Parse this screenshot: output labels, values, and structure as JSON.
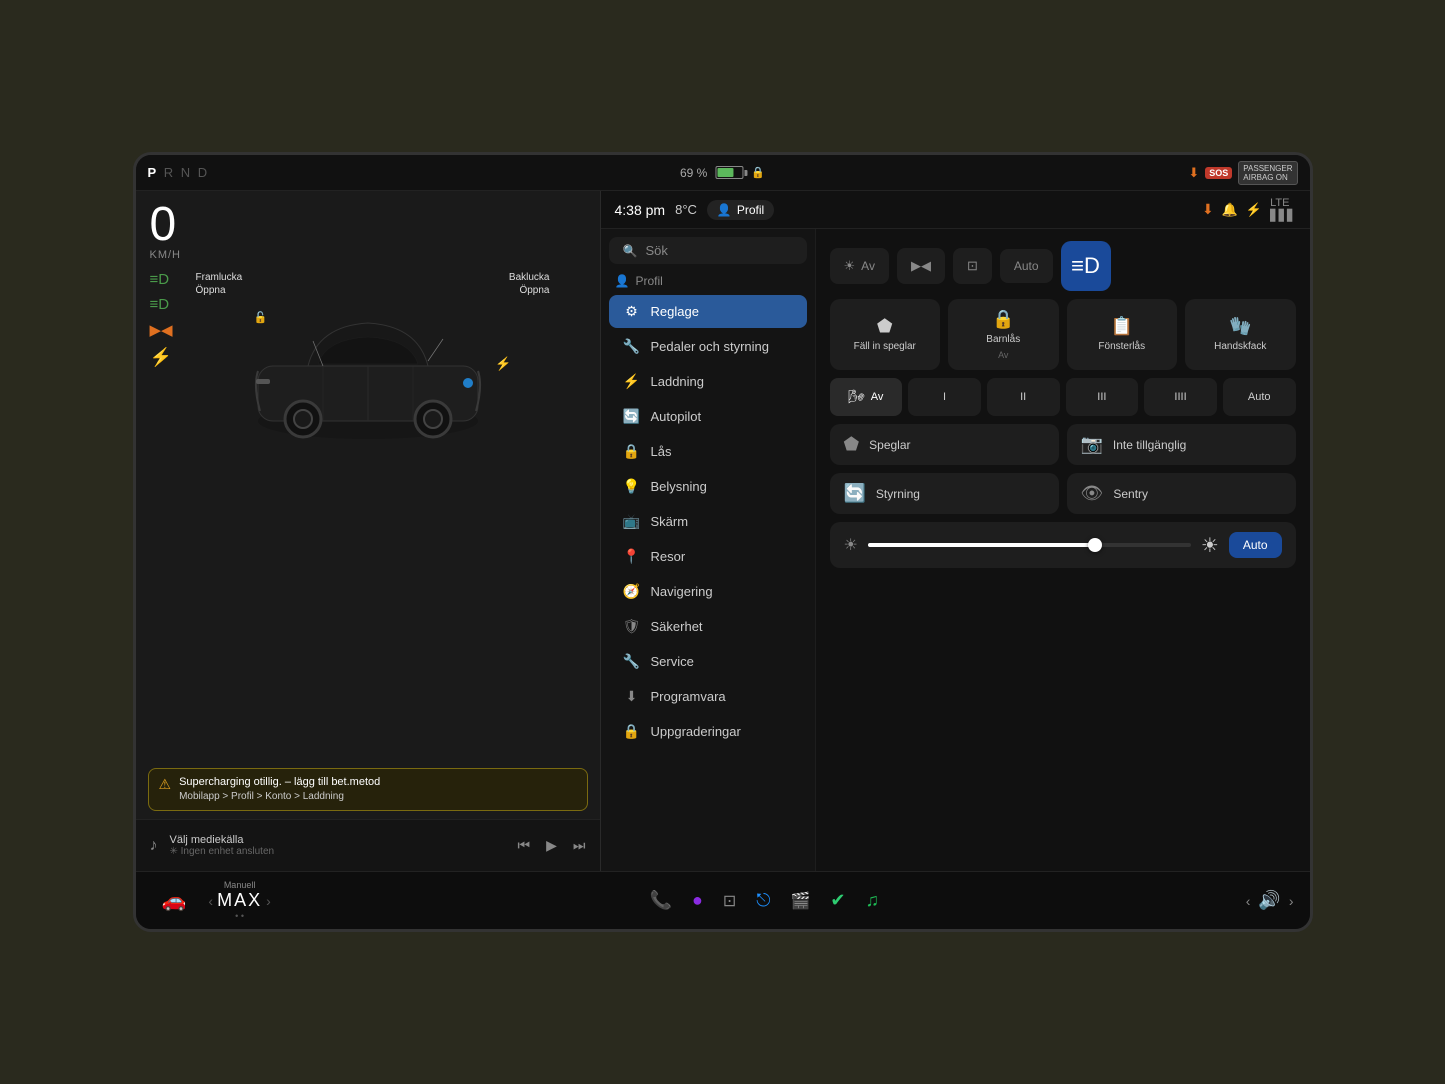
{
  "screen": {
    "top_bar": {
      "gear": "P R N D",
      "gear_active": "P",
      "battery_pct": "69 %",
      "lock_icon": "🔒",
      "time": "4:38 pm",
      "temperature": "8°C",
      "profile_label": "Profil",
      "top_right_icons": [
        "⬇",
        "SOS",
        "PASSENGER AIRBAG ON"
      ]
    },
    "left_panel": {
      "speed": "0",
      "speed_unit": "KM/H",
      "icons_left": [
        "≡D",
        "≡D",
        "▶◀",
        "⚡"
      ],
      "label_framlucka": "Framlucka\nÖppna",
      "label_baklucka": "Baklucka\nÖppna",
      "alert": {
        "icon": "⚠",
        "main": "Supercharging otillig. – lägg till bet.metod",
        "sub": "Mobilapp > Profil > Konto > Laddning"
      },
      "media": {
        "icon": "♪",
        "title": "Välj mediekälla",
        "subtitle": "✳ Ingen enhet ansluten",
        "controls": [
          "⏮",
          "▶",
          "⏭"
        ]
      }
    },
    "bottom_bar": {
      "car_icon": "🚗",
      "climate_label": "Manuell",
      "climate_value": "MAX",
      "left_arrow": "‹",
      "right_arrow": "›",
      "dots": "••",
      "taskbar_icons": [
        "📞",
        "🔮",
        "⊡",
        "⎋",
        "✔",
        "♫"
      ],
      "volume": {
        "left_arrow": "‹",
        "icon": "🔊",
        "right_arrow": "›"
      }
    },
    "right_panel": {
      "top": {
        "time": "4:38 pm",
        "temp": "8°C",
        "profile": "Profil",
        "icons_right": [
          "⬇",
          "🔔",
          "⚡",
          "LTE"
        ]
      },
      "menu_title_profile": "Profil",
      "menu_items": [
        {
          "icon": "⚙",
          "label": "Reglage",
          "active": true
        },
        {
          "icon": "🚗",
          "label": "Pedaler och styrning"
        },
        {
          "icon": "⚡",
          "label": "Laddning"
        },
        {
          "icon": "🔄",
          "label": "Autopilot"
        },
        {
          "icon": "🔒",
          "label": "Lås"
        },
        {
          "icon": "💡",
          "label": "Belysning"
        },
        {
          "icon": "📺",
          "label": "Skärm"
        },
        {
          "icon": "📍",
          "label": "Resor"
        },
        {
          "icon": "🧭",
          "label": "Navigering"
        },
        {
          "icon": "🛡",
          "label": "Säkerhet"
        },
        {
          "icon": "🔧",
          "label": "Service"
        },
        {
          "icon": "⬇",
          "label": "Programvara"
        },
        {
          "icon": "🔒",
          "label": "Uppgraderingar"
        }
      ],
      "settings": {
        "section_title": "Profil",
        "lighting_row": {
          "btn_off_label": "Av",
          "btn2": "▶◀",
          "btn3": "⊡",
          "btn_auto": "Auto",
          "btn_drl_active": true
        },
        "quick_btns": [
          {
            "icon": "⬟",
            "label": "Fäll in speglar"
          },
          {
            "icon": "🔒",
            "label": "Barnlås",
            "sub": "Av"
          },
          {
            "icon": "📋",
            "label": "Fönsterlås"
          },
          {
            "icon": "🧤",
            "label": "Handskfack"
          }
        ],
        "wiper_btns": [
          {
            "label": "Av",
            "active": true,
            "icon": "🌬"
          },
          {
            "label": "I"
          },
          {
            "label": "II"
          },
          {
            "label": "III"
          },
          {
            "label": "IIII"
          },
          {
            "label": "Auto"
          }
        ],
        "feature_btns": [
          {
            "icon": "⬟",
            "label": "Speglar"
          },
          {
            "icon": "📷",
            "label": "Inte tillgänglig"
          },
          {
            "icon": "🔄",
            "label": "Styrning"
          },
          {
            "icon": "👁",
            "label": "Sentry"
          }
        ],
        "brightness": {
          "fill_pct": 70,
          "auto_label": "Auto"
        }
      }
    }
  }
}
